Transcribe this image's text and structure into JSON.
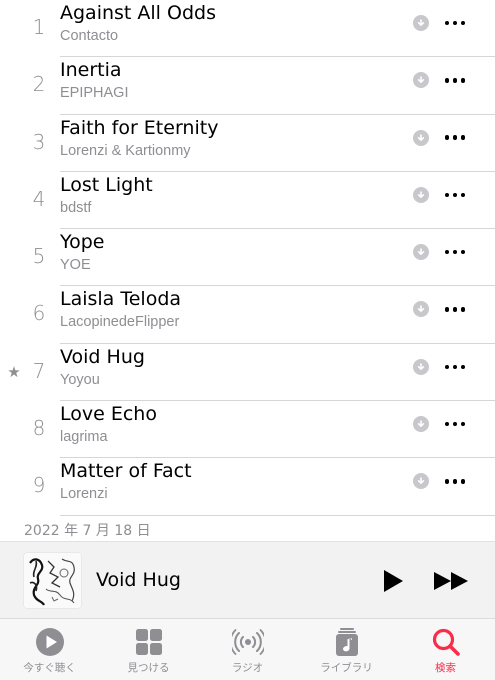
{
  "tracks": [
    {
      "number": "1",
      "title": "Against All Odds",
      "artist": "Contacto",
      "starred": false
    },
    {
      "number": "2",
      "title": "Inertia",
      "artist": "EPIPHAGI",
      "starred": false
    },
    {
      "number": "3",
      "title": "Faith for Eternity",
      "artist": "Lorenzi & Kartionmy",
      "starred": false
    },
    {
      "number": "4",
      "title": "Lost Light",
      "artist": "bdstf",
      "starred": false
    },
    {
      "number": "5",
      "title": "Yope",
      "artist": "YOE",
      "starred": false
    },
    {
      "number": "6",
      "title": "Laisla Teloda",
      "artist": "LacopinedeFlipper",
      "starred": false
    },
    {
      "number": "7",
      "title": "Void Hug",
      "artist": "Yoyou",
      "starred": true,
      "star": "★"
    },
    {
      "number": "8",
      "title": "Love Echo",
      "artist": "lagrima",
      "starred": false
    },
    {
      "number": "9",
      "title": "Matter of Fact",
      "artist": "Lorenzi",
      "starred": false
    }
  ],
  "release_date": "2022 年 7 月 18 日",
  "now_playing": {
    "title": "Void Hug",
    "artwork_icon": "album-artwork",
    "play_icon": "play-icon",
    "forward_icon": "fast-forward-icon"
  },
  "tabs": [
    {
      "label": "今すぐ聴く",
      "icon": "listen-now-icon",
      "active": false
    },
    {
      "label": "見つける",
      "icon": "browse-grid-icon",
      "active": false
    },
    {
      "label": "ラジオ",
      "icon": "radio-icon",
      "active": false
    },
    {
      "label": "ライブラリ",
      "icon": "library-icon",
      "active": false
    },
    {
      "label": "検索",
      "icon": "search-icon",
      "active": true
    }
  ],
  "colors": {
    "accent": "#fa2d48",
    "secondary_text": "#8e8e93",
    "inactive_icon": "#8e8e93",
    "player_background": "#f2f2f2"
  }
}
